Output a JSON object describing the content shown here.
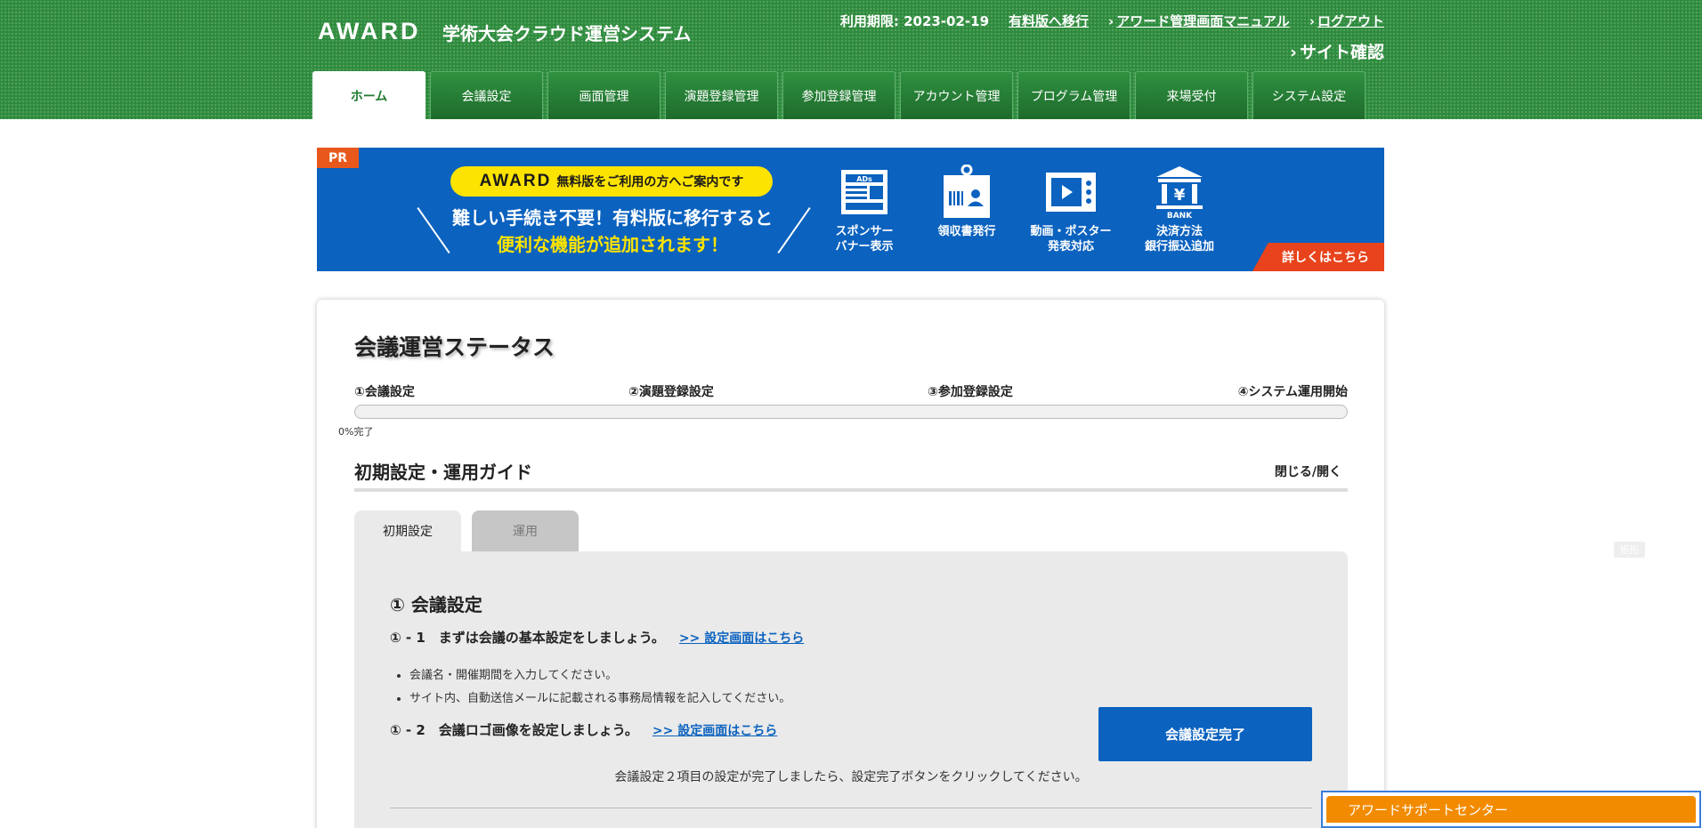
{
  "header": {
    "logo": "AWARD",
    "system_title": "学術大会クラウド運営システム",
    "expiry": "利用期限: 2023-02-19",
    "upgrade_link": "有料版へ移行",
    "manual_link": "アワード管理画面マニュアル",
    "logout_link": "ログアウト",
    "site_check": "サイト確認"
  },
  "nav": {
    "tabs": [
      {
        "label": "ホーム",
        "active": true
      },
      {
        "label": "会議設定"
      },
      {
        "label": "画面管理"
      },
      {
        "label": "演題登録管理"
      },
      {
        "label": "参加登録管理"
      },
      {
        "label": "アカウント管理"
      },
      {
        "label": "プログラム管理"
      },
      {
        "label": "来場受付"
      },
      {
        "label": "システム設定"
      }
    ]
  },
  "banner": {
    "pr": "PR",
    "pill_logo": "AWARD",
    "pill_text": "無料版をご利用の方へご案内です",
    "line1": "難しい手続き不要！有料版に移行すると",
    "line2": "便利な機能が追加されます！",
    "features": [
      {
        "label": "スポンサー\nバナー表示",
        "icon": "ads-icon"
      },
      {
        "label": "領収書発行",
        "icon": "badge-icon"
      },
      {
        "label": "動画・ポスター\n発表対応",
        "icon": "video-icon"
      },
      {
        "label": "決済方法\n銀行振込追加",
        "icon": "bank-icon"
      }
    ],
    "ads_text": "ADs",
    "yen_text": "¥",
    "bank_text": "BANK",
    "more": "詳しくはこちら"
  },
  "status": {
    "title": "会議運営ステータス",
    "steps": [
      "①会議設定",
      "②演題登録設定",
      "③参加登録設定",
      "④システム運用開始"
    ],
    "progress_percent": 0,
    "progress_text": "0%完了"
  },
  "guide": {
    "title": "初期設定・運用ガイド",
    "toggle": "閉じる/開く",
    "tabs": [
      "初期設定",
      "運用"
    ],
    "section_title": "① 会議設定",
    "step1_heading": "① - 1　まずは会議の基本設定をしましょう。",
    "step1_link": ">> 設定画面はこちら",
    "bullets": [
      "会議名・開催期間を入力してください。",
      "サイト内、自動送信メールに記載される事務局情報を記入してください。"
    ],
    "step2_heading": "① - 2　会議ロゴ画像を設定しましょう。",
    "step2_link": ">> 設定画面はこちら",
    "done_button": "会議設定完了",
    "note": "会議設定２項目の設定が完了しましたら、設定完了ボタンをクリックしてください。"
  },
  "floating": {
    "tag": "矩形",
    "support": "アワードサポートセンター"
  },
  "colors": {
    "header_green": "#2e8b3d",
    "banner_blue": "#0b62bf",
    "accent_yellow": "#fde300",
    "accent_red": "#e8431c",
    "support_orange": "#f28b00"
  }
}
